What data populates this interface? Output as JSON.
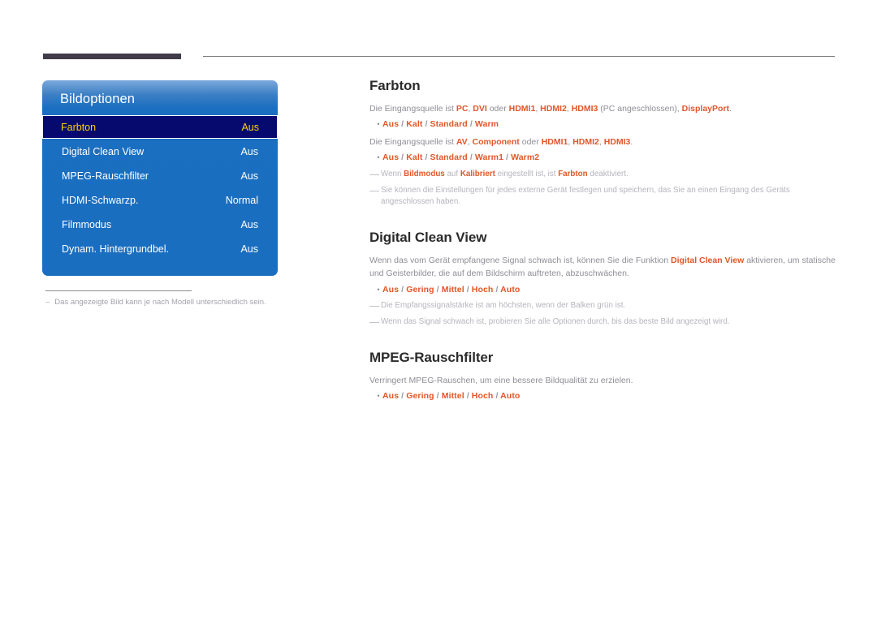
{
  "page": {
    "language": "de",
    "accent_orange": "#e2562a",
    "osd_blue": "#1a6ec0",
    "osd_selected_navy": "#060a6e",
    "osd_selected_text": "#ffd200",
    "body_gray": "#8e8e97"
  },
  "osd": {
    "title": "Bildoptionen",
    "rows": [
      {
        "label": "Farbton",
        "value": "Aus",
        "selected": true
      },
      {
        "label": "Digital Clean View",
        "value": "Aus",
        "selected": false
      },
      {
        "label": "MPEG-Rauschfilter",
        "value": "Aus",
        "selected": false
      },
      {
        "label": "HDMI-Schwarzp.",
        "value": "Normal",
        "selected": false
      },
      {
        "label": "Filmmodus",
        "value": "Aus",
        "selected": false
      },
      {
        "label": "Dynam. Hintergrundbel.",
        "value": "Aus",
        "selected": false
      }
    ],
    "footnote_dash": "–",
    "footnote": "Das angezeigte Bild kann je nach Modell unterschiedlich sein."
  },
  "sections": {
    "farbton": {
      "heading": "Farbton",
      "para1_pre": "Die Eingangsquelle ist ",
      "para1_b1": "PC",
      "para1_s1": ", ",
      "para1_b2": "DVI",
      "para1_s2": " oder ",
      "para1_b3": "HDMI1",
      "para1_s3": ", ",
      "para1_b4": "HDMI2",
      "para1_s4": ", ",
      "para1_b5": "HDMI3",
      "para1_s5": " (PC angeschlossen), ",
      "para1_b6": "DisplayPort",
      "para1_end": ".",
      "bullet1": {
        "dot": "•",
        "o1": "Aus",
        "sep1": " / ",
        "o2": "Kalt",
        "sep2": " / ",
        "o3": "Standard",
        "sep3": " / ",
        "o4": "Warm"
      },
      "para2_pre": "Die Eingangsquelle ist ",
      "para2_b1": "AV",
      "para2_s1": ", ",
      "para2_b2": "Component",
      "para2_s2": "  oder ",
      "para2_b3": "HDMI1",
      "para2_s3": ", ",
      "para2_b4": "HDMI2",
      "para2_s4": ", ",
      "para2_b5": "HDMI3",
      "para2_end": ".",
      "bullet2": {
        "dot": "•",
        "o1": "Aus",
        "sep1": " / ",
        "o2": "Kalt",
        "sep2": " / ",
        "o3": "Standard",
        "sep3": " / ",
        "o4": "Warm1",
        "sep4": " / ",
        "o5": "Warm2"
      },
      "note1_a": "Wenn ",
      "note1_b1": "Bildmodus",
      "note1_b": " auf ",
      "note1_b2": "Kalibriert",
      "note1_c": " eingestellt ist, ist ",
      "note1_b3": "Farbton",
      "note1_d": " deaktiviert.",
      "note2": "Sie können die Einstellungen für jedes externe Gerät festlegen und speichern, das Sie an einen Eingang des Geräts angeschlossen haben."
    },
    "digital_clean_view": {
      "heading": "Digital Clean View",
      "para_a": "Wenn das vom Gerät empfangene Signal schwach ist, können Sie die Funktion ",
      "para_b1": "Digital Clean View",
      "para_b": " aktivieren, um statische und Geisterbilder, die auf dem Bildschirm auftreten, abzuschwächen.",
      "bullet": {
        "dot": "•",
        "o1": "Aus",
        "sep1": " / ",
        "o2": "Gering",
        "sep2": " / ",
        "o3": "Mittel",
        "sep3": " / ",
        "o4": "Hoch",
        "sep4": " / ",
        "o5": "Auto"
      },
      "note1": "Die Empfangssignalstärke ist am höchsten, wenn der Balken grün ist.",
      "note2": "Wenn das Signal schwach ist, probieren Sie alle Optionen durch, bis das beste Bild angezeigt wird."
    },
    "mpeg": {
      "heading": "MPEG-Rauschfilter",
      "para": "Verringert MPEG-Rauschen, um eine bessere Bildqualität zu erzielen.",
      "bullet": {
        "dot": "•",
        "o1": "Aus",
        "sep1": " / ",
        "o2": "Gering",
        "sep2": " / ",
        "o3": "Mittel",
        "sep3": " / ",
        "o4": "Hoch",
        "sep4": " / ",
        "o5": "Auto"
      }
    }
  }
}
